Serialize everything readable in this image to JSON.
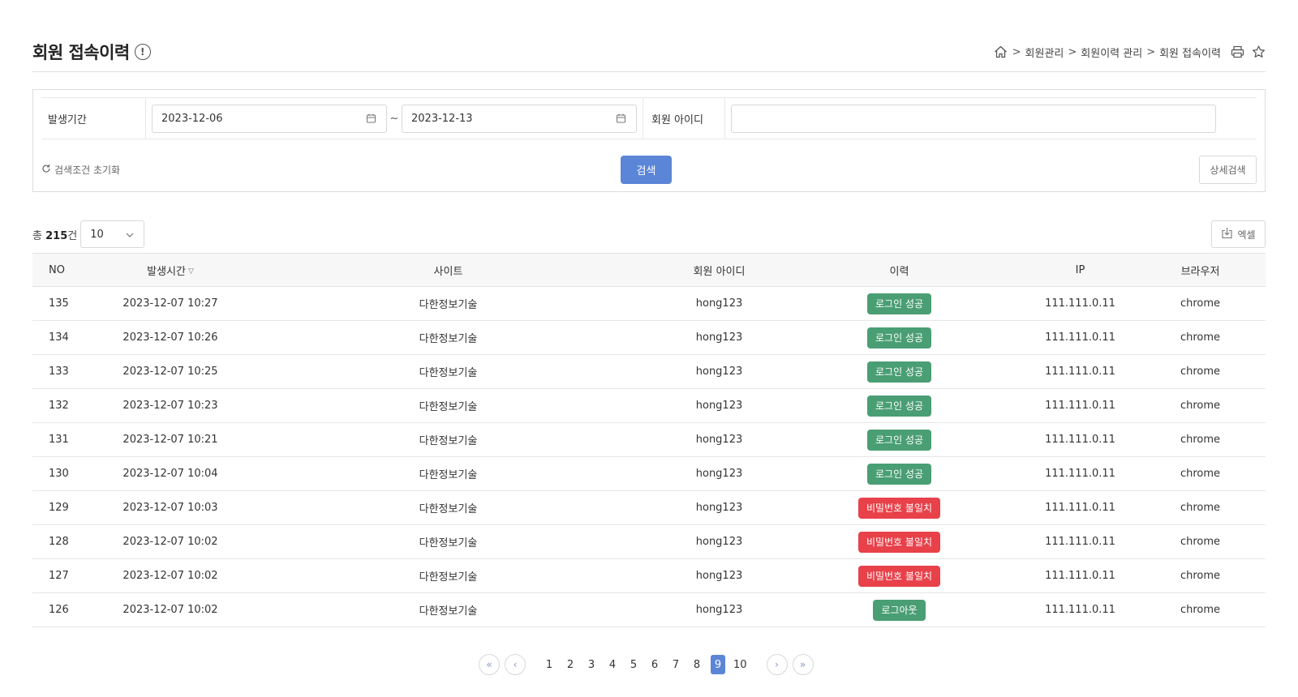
{
  "header": {
    "title": "회원 접속이력",
    "info_icon": "!",
    "breadcrumb": [
      "회원관리",
      "회원이력 관리",
      "회원 접속이력"
    ],
    "breadcrumb_sep": ">"
  },
  "search": {
    "period_label": "발생기간",
    "start_date": "2023-12-06",
    "end_date": "2023-12-13",
    "range_sep": "~",
    "member_id_label": "회원 아이디",
    "member_id_value": "",
    "reset_label": "검색조건 초기화",
    "search_button": "검색",
    "advanced_button": "상세검색"
  },
  "summary": {
    "total_prefix": "총",
    "total_count": "215",
    "total_suffix": "건",
    "page_size": "10",
    "excel_button": "엑셀"
  },
  "table": {
    "columns": [
      "NO",
      "발생시간",
      "사이트",
      "회원 아이디",
      "이력",
      "IP",
      "브라우저"
    ],
    "rows": [
      {
        "no": "135",
        "time": "2023-12-07 10:27",
        "site": "다한정보기술",
        "member_id": "hong123",
        "history": "로그인 성공",
        "status": "success",
        "ip": "111.111.0.11",
        "browser": "chrome"
      },
      {
        "no": "134",
        "time": "2023-12-07 10:26",
        "site": "다한정보기술",
        "member_id": "hong123",
        "history": "로그인 성공",
        "status": "success",
        "ip": "111.111.0.11",
        "browser": "chrome"
      },
      {
        "no": "133",
        "time": "2023-12-07 10:25",
        "site": "다한정보기술",
        "member_id": "hong123",
        "history": "로그인 성공",
        "status": "success",
        "ip": "111.111.0.11",
        "browser": "chrome"
      },
      {
        "no": "132",
        "time": "2023-12-07 10:23",
        "site": "다한정보기술",
        "member_id": "hong123",
        "history": "로그인 성공",
        "status": "success",
        "ip": "111.111.0.11",
        "browser": "chrome"
      },
      {
        "no": "131",
        "time": "2023-12-07 10:21",
        "site": "다한정보기술",
        "member_id": "hong123",
        "history": "로그인 성공",
        "status": "success",
        "ip": "111.111.0.11",
        "browser": "chrome"
      },
      {
        "no": "130",
        "time": "2023-12-07 10:04",
        "site": "다한정보기술",
        "member_id": "hong123",
        "history": "로그인 성공",
        "status": "success",
        "ip": "111.111.0.11",
        "browser": "chrome"
      },
      {
        "no": "129",
        "time": "2023-12-07 10:03",
        "site": "다한정보기술",
        "member_id": "hong123",
        "history": "비밀번호 불일치",
        "status": "error",
        "ip": "111.111.0.11",
        "browser": "chrome"
      },
      {
        "no": "128",
        "time": "2023-12-07 10:02",
        "site": "다한정보기술",
        "member_id": "hong123",
        "history": "비밀번호 불일치",
        "status": "error",
        "ip": "111.111.0.11",
        "browser": "chrome"
      },
      {
        "no": "127",
        "time": "2023-12-07 10:02",
        "site": "다한정보기술",
        "member_id": "hong123",
        "history": "비밀번호 불일치",
        "status": "error",
        "ip": "111.111.0.11",
        "browser": "chrome"
      },
      {
        "no": "126",
        "time": "2023-12-07 10:02",
        "site": "다한정보기술",
        "member_id": "hong123",
        "history": "로그아웃",
        "status": "logout",
        "ip": "111.111.0.11",
        "browser": "chrome"
      }
    ]
  },
  "status_colors": {
    "success": "#4a9e74",
    "error": "#e8414a",
    "logout": "#4a9e74"
  },
  "pagination": {
    "pages": [
      "1",
      "2",
      "3",
      "4",
      "5",
      "6",
      "7",
      "8",
      "9",
      "10"
    ],
    "current": "9",
    "first": "«",
    "prev": "‹",
    "next": "›",
    "last": "»"
  },
  "icons": {
    "home": "home-icon",
    "print": "print-icon",
    "favorite": "star-icon",
    "calendar": "calendar-icon",
    "reset": "refresh-icon",
    "dropdown": "chevron-down-icon",
    "excel": "download-icon",
    "sort": "sort-down-icon"
  }
}
